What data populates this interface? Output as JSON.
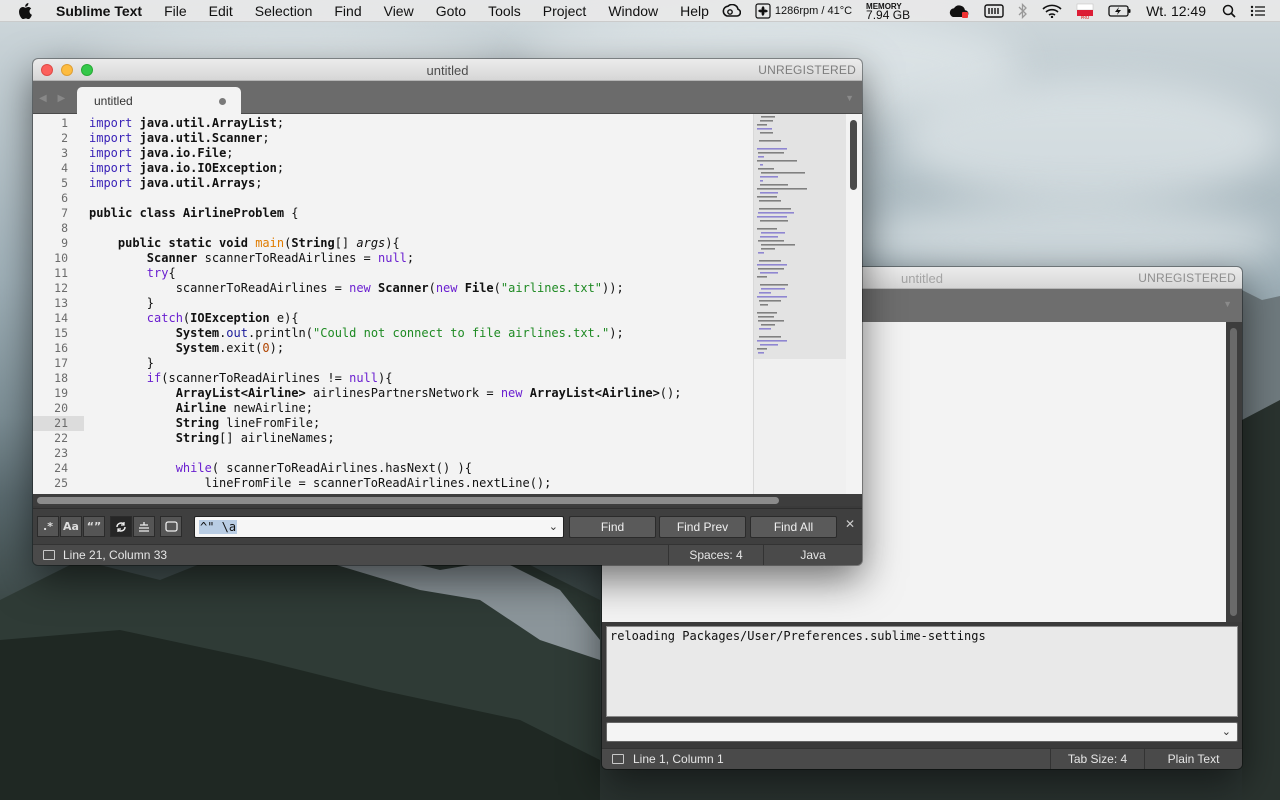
{
  "menubar": {
    "app_name": "Sublime Text",
    "items": [
      "File",
      "Edit",
      "Selection",
      "Find",
      "View",
      "Goto",
      "Tools",
      "Project",
      "Window",
      "Help"
    ],
    "fan_temp": "1286rpm / 41°C",
    "memory_label": "MEMORY",
    "memory_value": "7.94 GB",
    "clock": "Wt. 12:49"
  },
  "main_window": {
    "title": "untitled",
    "registration": "UNREGISTERED",
    "tab_label": "untitled",
    "code": [
      [
        [
          "imp",
          "import"
        ],
        [
          "p",
          " "
        ],
        [
          "ty",
          "java.util.ArrayList"
        ],
        [
          "p",
          ";"
        ]
      ],
      [
        [
          "imp",
          "import"
        ],
        [
          "p",
          " "
        ],
        [
          "ty",
          "java.util.Scanner"
        ],
        [
          "p",
          ";"
        ]
      ],
      [
        [
          "imp",
          "import"
        ],
        [
          "p",
          " "
        ],
        [
          "ty",
          "java.io.File"
        ],
        [
          "p",
          ";"
        ]
      ],
      [
        [
          "imp",
          "import"
        ],
        [
          "p",
          " "
        ],
        [
          "ty",
          "java.io.IOException"
        ],
        [
          "p",
          ";"
        ]
      ],
      [
        [
          "imp",
          "import"
        ],
        [
          "p",
          " "
        ],
        [
          "ty",
          "java.util.Arrays"
        ],
        [
          "p",
          ";"
        ]
      ],
      [],
      [
        [
          "ty",
          "public class AirlineProblem"
        ],
        [
          "p",
          " {"
        ]
      ],
      [],
      [
        [
          "p",
          "    "
        ],
        [
          "ty",
          "public static void"
        ],
        [
          "p",
          " "
        ],
        [
          "fn",
          "main"
        ],
        [
          "p",
          "("
        ],
        [
          "ty",
          "String"
        ],
        [
          "p",
          "[] "
        ],
        [
          "it",
          "args"
        ],
        [
          "p",
          "){"
        ]
      ],
      [
        [
          "p",
          "        "
        ],
        [
          "ty",
          "Scanner"
        ],
        [
          "p",
          " scannerToReadAirlines = "
        ],
        [
          "kw",
          "null"
        ],
        [
          "p",
          ";"
        ]
      ],
      [
        [
          "p",
          "        "
        ],
        [
          "kw",
          "try"
        ],
        [
          "p",
          "{"
        ]
      ],
      [
        [
          "p",
          "            scannerToReadAirlines = "
        ],
        [
          "kw",
          "new"
        ],
        [
          "p",
          " "
        ],
        [
          "ty",
          "Scanner"
        ],
        [
          "p",
          "("
        ],
        [
          "kw",
          "new"
        ],
        [
          "p",
          " "
        ],
        [
          "ty",
          "File"
        ],
        [
          "p",
          "("
        ],
        [
          "str",
          "\"airlines.txt\""
        ],
        [
          "p",
          "));"
        ]
      ],
      [
        [
          "p",
          "        }"
        ]
      ],
      [
        [
          "p",
          "        "
        ],
        [
          "kw",
          "catch"
        ],
        [
          "p",
          "("
        ],
        [
          "ty",
          "IOException"
        ],
        [
          "p",
          " e){"
        ]
      ],
      [
        [
          "p",
          "            "
        ],
        [
          "ty",
          "System"
        ],
        [
          "p",
          "."
        ],
        [
          "kw2",
          "out"
        ],
        [
          "p",
          ".println("
        ],
        [
          "str",
          "\"Could not connect to file airlines.txt.\""
        ],
        [
          "p",
          ");"
        ]
      ],
      [
        [
          "p",
          "            "
        ],
        [
          "ty",
          "System"
        ],
        [
          "p",
          ".exit("
        ],
        [
          "num",
          "0"
        ],
        [
          "p",
          ");"
        ]
      ],
      [
        [
          "p",
          "        }"
        ]
      ],
      [
        [
          "p",
          "        "
        ],
        [
          "kw",
          "if"
        ],
        [
          "p",
          "(scannerToReadAirlines != "
        ],
        [
          "kw",
          "null"
        ],
        [
          "p",
          "){"
        ]
      ],
      [
        [
          "p",
          "            "
        ],
        [
          "ty",
          "ArrayList<Airline>"
        ],
        [
          "p",
          " airlinesPartnersNetwork = "
        ],
        [
          "kw",
          "new"
        ],
        [
          "p",
          " "
        ],
        [
          "ty",
          "ArrayList<Airline>"
        ],
        [
          "p",
          "();"
        ]
      ],
      [
        [
          "p",
          "            "
        ],
        [
          "ty",
          "Airline"
        ],
        [
          "p",
          " newAirline;"
        ]
      ],
      [
        [
          "p",
          "            "
        ],
        [
          "ty",
          "String"
        ],
        [
          "p",
          " lineFromFile;"
        ]
      ],
      [
        [
          "p",
          "            "
        ],
        [
          "ty",
          "String"
        ],
        [
          "p",
          "[] airlineNames;"
        ]
      ],
      [],
      [
        [
          "p",
          "            "
        ],
        [
          "kw",
          "while"
        ],
        [
          "p",
          "( scannerToReadAirlines.hasNext() ){"
        ]
      ],
      [
        [
          "p",
          "                lineFromFile = scannerToReadAirlines.nextLine();"
        ]
      ]
    ],
    "current_line": 21,
    "find": {
      "query": "^\" \\a",
      "buttons": [
        "Find",
        "Find Prev",
        "Find All"
      ],
      "toggles": [
        ".*",
        "Aa",
        "“”"
      ]
    },
    "status": {
      "position": "Line 21, Column 33",
      "spaces": "Spaces: 4",
      "syntax": "Java"
    }
  },
  "second_window": {
    "title": "untitled",
    "registration": "UNREGISTERED",
    "console_output": "reloading Packages/User/Preferences.sublime-settings",
    "status": {
      "position": "Line 1, Column 1",
      "tab_size": "Tab Size: 4",
      "syntax": "Plain Text"
    }
  }
}
